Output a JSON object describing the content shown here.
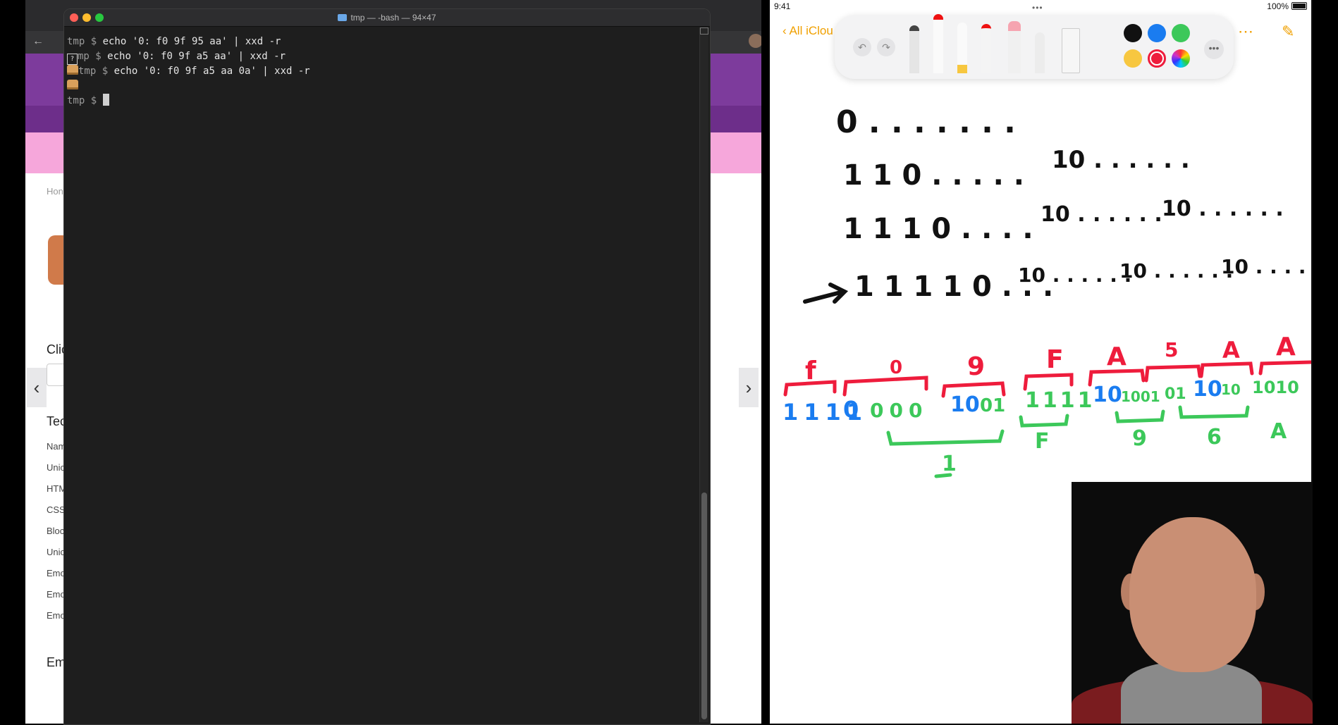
{
  "terminal": {
    "title": "tmp — -bash — 94×47",
    "lines": [
      {
        "prefix": "",
        "prompt": "tmp $ ",
        "command": "echo '0: f0 9f 95 aa' | xxd -r"
      },
      {
        "prefix": "?",
        "prompt": "mp $ ",
        "command": "echo '0: f0 9f a5 aa' | xxd -r"
      },
      {
        "prefix": "sandwich",
        "prompt": "tmp $ ",
        "command": "echo '0: f0 9f a5 aa 0a' | xxd -r"
      },
      {
        "prefix": "sandwich",
        "prompt": "",
        "command": ""
      },
      {
        "prefix": "",
        "prompt": "tmp $ ",
        "command": ""
      }
    ]
  },
  "browser": {
    "breadcrumb": "Hon",
    "side_labels": [
      "Nam",
      "Unic",
      "HTM",
      "CSS",
      "Bloc",
      "Unic",
      "Emo",
      "Emo",
      "Emo"
    ],
    "heading_click": "Clic",
    "heading_tech": "Tec",
    "heading_em": "Em"
  },
  "ipad": {
    "time": "9:41",
    "battery": "100%",
    "back_label": "All iClou",
    "colors": {
      "black": "#111111",
      "blue": "#1a7cf0",
      "green": "#3cc85a",
      "yellow": "#f7c740",
      "red": "#ee1c3c"
    },
    "notes": {
      "row1": [
        "0 . . . . . . ."
      ],
      "row2": [
        "1 1 0 . . . . .",
        "10 . . . . . ."
      ],
      "row3": [
        "1 1 1 0 . . . .",
        "10 . . . . . .",
        "10 . . . . . ."
      ],
      "row4": [
        "1 1 1 1 0 . . .",
        "10 . . . . . .",
        "10 . . . . . .",
        "10 . . . . . ."
      ],
      "hex_red": [
        "f",
        "0",
        "9",
        "F",
        "A",
        "5",
        "A",
        "A"
      ],
      "bits_blue_green": [
        "1111",
        "0",
        "000",
        "10",
        "01",
        "1111",
        "10",
        "1001",
        "01",
        "10",
        "10",
        "1010"
      ],
      "hex_green": [
        "F",
        "9",
        "6",
        "A",
        "1"
      ]
    }
  }
}
